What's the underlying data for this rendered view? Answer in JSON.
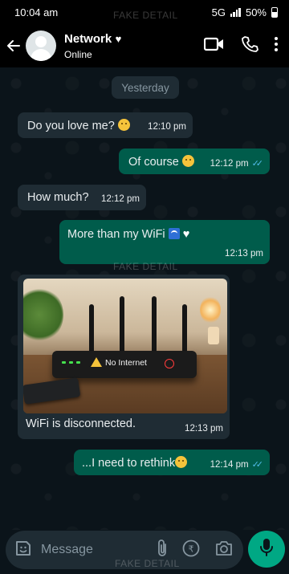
{
  "status_bar": {
    "time": "10:04 am",
    "network": "5G",
    "battery": "50%"
  },
  "watermark": "FAKE DETAIL",
  "header": {
    "contact_name": "Network",
    "contact_status": "Online"
  },
  "chat": {
    "day_label": "Yesterday",
    "messages": [
      {
        "dir": "in",
        "text": "Do you love me?",
        "time": "12:10 pm"
      },
      {
        "dir": "out",
        "text": "Of course",
        "time": "12:12 pm"
      },
      {
        "dir": "in",
        "text": "How much?",
        "time": "12:12 pm"
      },
      {
        "dir": "out",
        "text": "More than my WiFi",
        "time": "12:13 pm"
      },
      {
        "dir": "in",
        "text": "WiFi is disconnected.",
        "time": "12:13 pm",
        "image_caption": "No Internet"
      },
      {
        "dir": "out",
        "text": "...I need to rethink",
        "time": "12:14 pm"
      }
    ]
  },
  "composer": {
    "placeholder": "Message"
  },
  "colors": {
    "background": "#0b141a",
    "incoming_bubble": "#1f2c34",
    "outgoing_bubble": "#005c4b",
    "accent": "#00a884",
    "read_ticks": "#53bdeb"
  }
}
